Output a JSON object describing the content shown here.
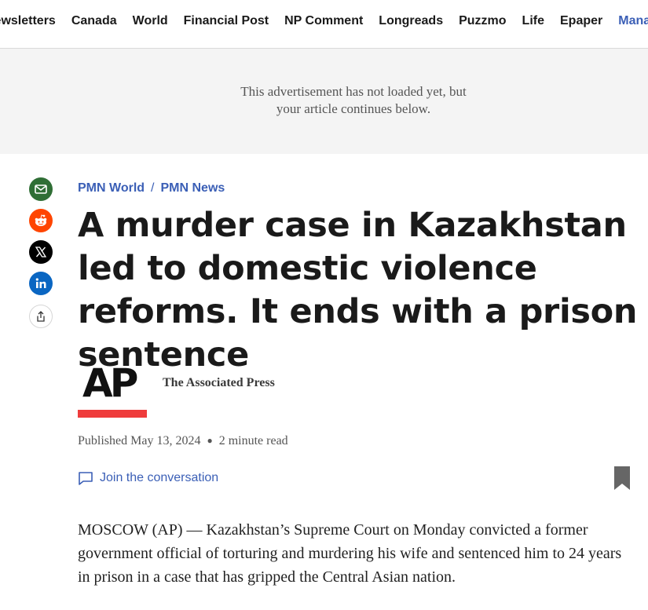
{
  "nav": {
    "items": [
      "Newsletters",
      "Canada",
      "World",
      "Financial Post",
      "NP Comment",
      "Longreads",
      "Puzzmo",
      "Life",
      "Epaper"
    ],
    "manage_label": "Manage Print Subscription"
  },
  "ad": {
    "line1": "This advertisement has not loaded yet, but",
    "line2": "your article continues below."
  },
  "share": {
    "icons": [
      "email-icon",
      "reddit-icon",
      "x-icon",
      "linkedin-icon",
      "share-icon"
    ],
    "colors": {
      "email": "#2f6e35",
      "reddit": "#ff4500",
      "x": "#000000",
      "linkedin": "#0a66c2"
    }
  },
  "breadcrumbs": {
    "first": "PMN World",
    "separator": "/",
    "second": "PMN News"
  },
  "article": {
    "headline": "A murder case in Kazakhstan led to domestic violence reforms. It ends with a prison sentence",
    "author": "The Associated Press",
    "logo_text": "AP",
    "published": "Published May 13, 2024",
    "read_time": "2 minute read",
    "conversation": "Join the conversation",
    "lede": "MOSCOW (AP) — Kazakhstan’s Supreme Court on Monday convicted a former government official of torturing and murdering his wife and sentenced him to 24 years in prison in a case that has gripped the Central Asian nation."
  },
  "colors": {
    "link": "#3b5fb6",
    "ap_red": "#ef3c3c"
  }
}
